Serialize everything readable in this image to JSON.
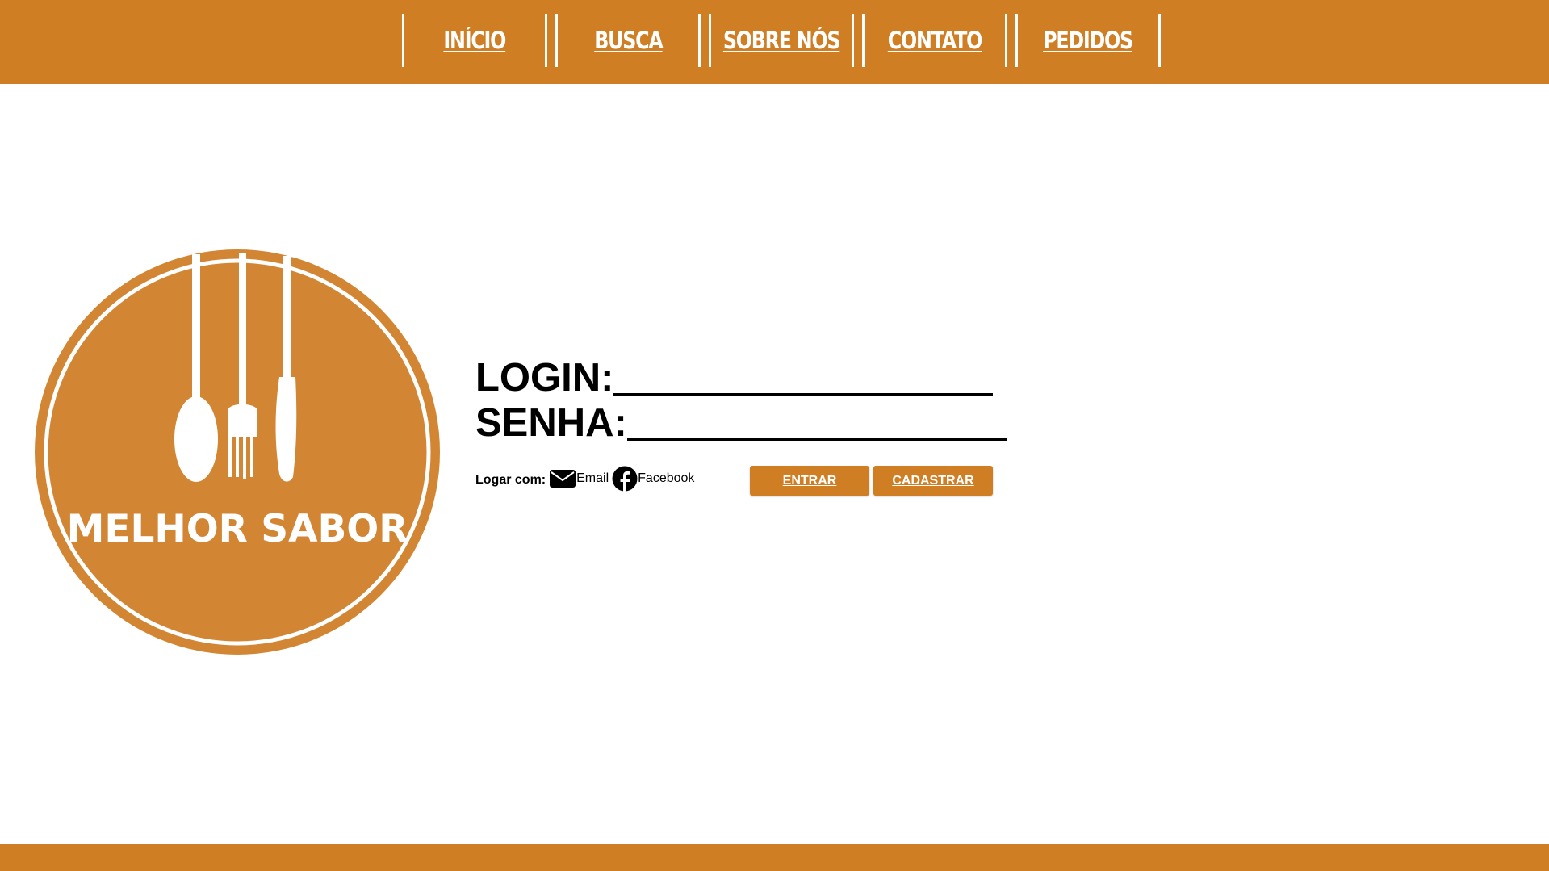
{
  "nav": {
    "items": [
      {
        "label": "INÍCIO"
      },
      {
        "label": "BUSCA"
      },
      {
        "label": "SOBRE NÓS"
      },
      {
        "label": "CONTATO"
      },
      {
        "label": "PEDIDOS"
      }
    ]
  },
  "logo": {
    "text": "MELHOR SABOR",
    "icons": [
      "spoon-icon",
      "fork-icon",
      "knife-icon"
    ]
  },
  "form": {
    "login_label": "LOGIN:",
    "login_value": "",
    "password_label": "SENHA:",
    "password_value": "",
    "login_with_label": "Logar com:",
    "providers": [
      {
        "label": "Email",
        "icon": "envelope-icon"
      },
      {
        "label": "Facebook",
        "icon": "facebook-icon"
      }
    ],
    "enter_button": "ENTRAR",
    "register_button": "CADASTRAR"
  },
  "colors": {
    "brand": "#d07e24",
    "logo_fill": "#d28634",
    "text": "#000000",
    "white": "#ffffff"
  }
}
